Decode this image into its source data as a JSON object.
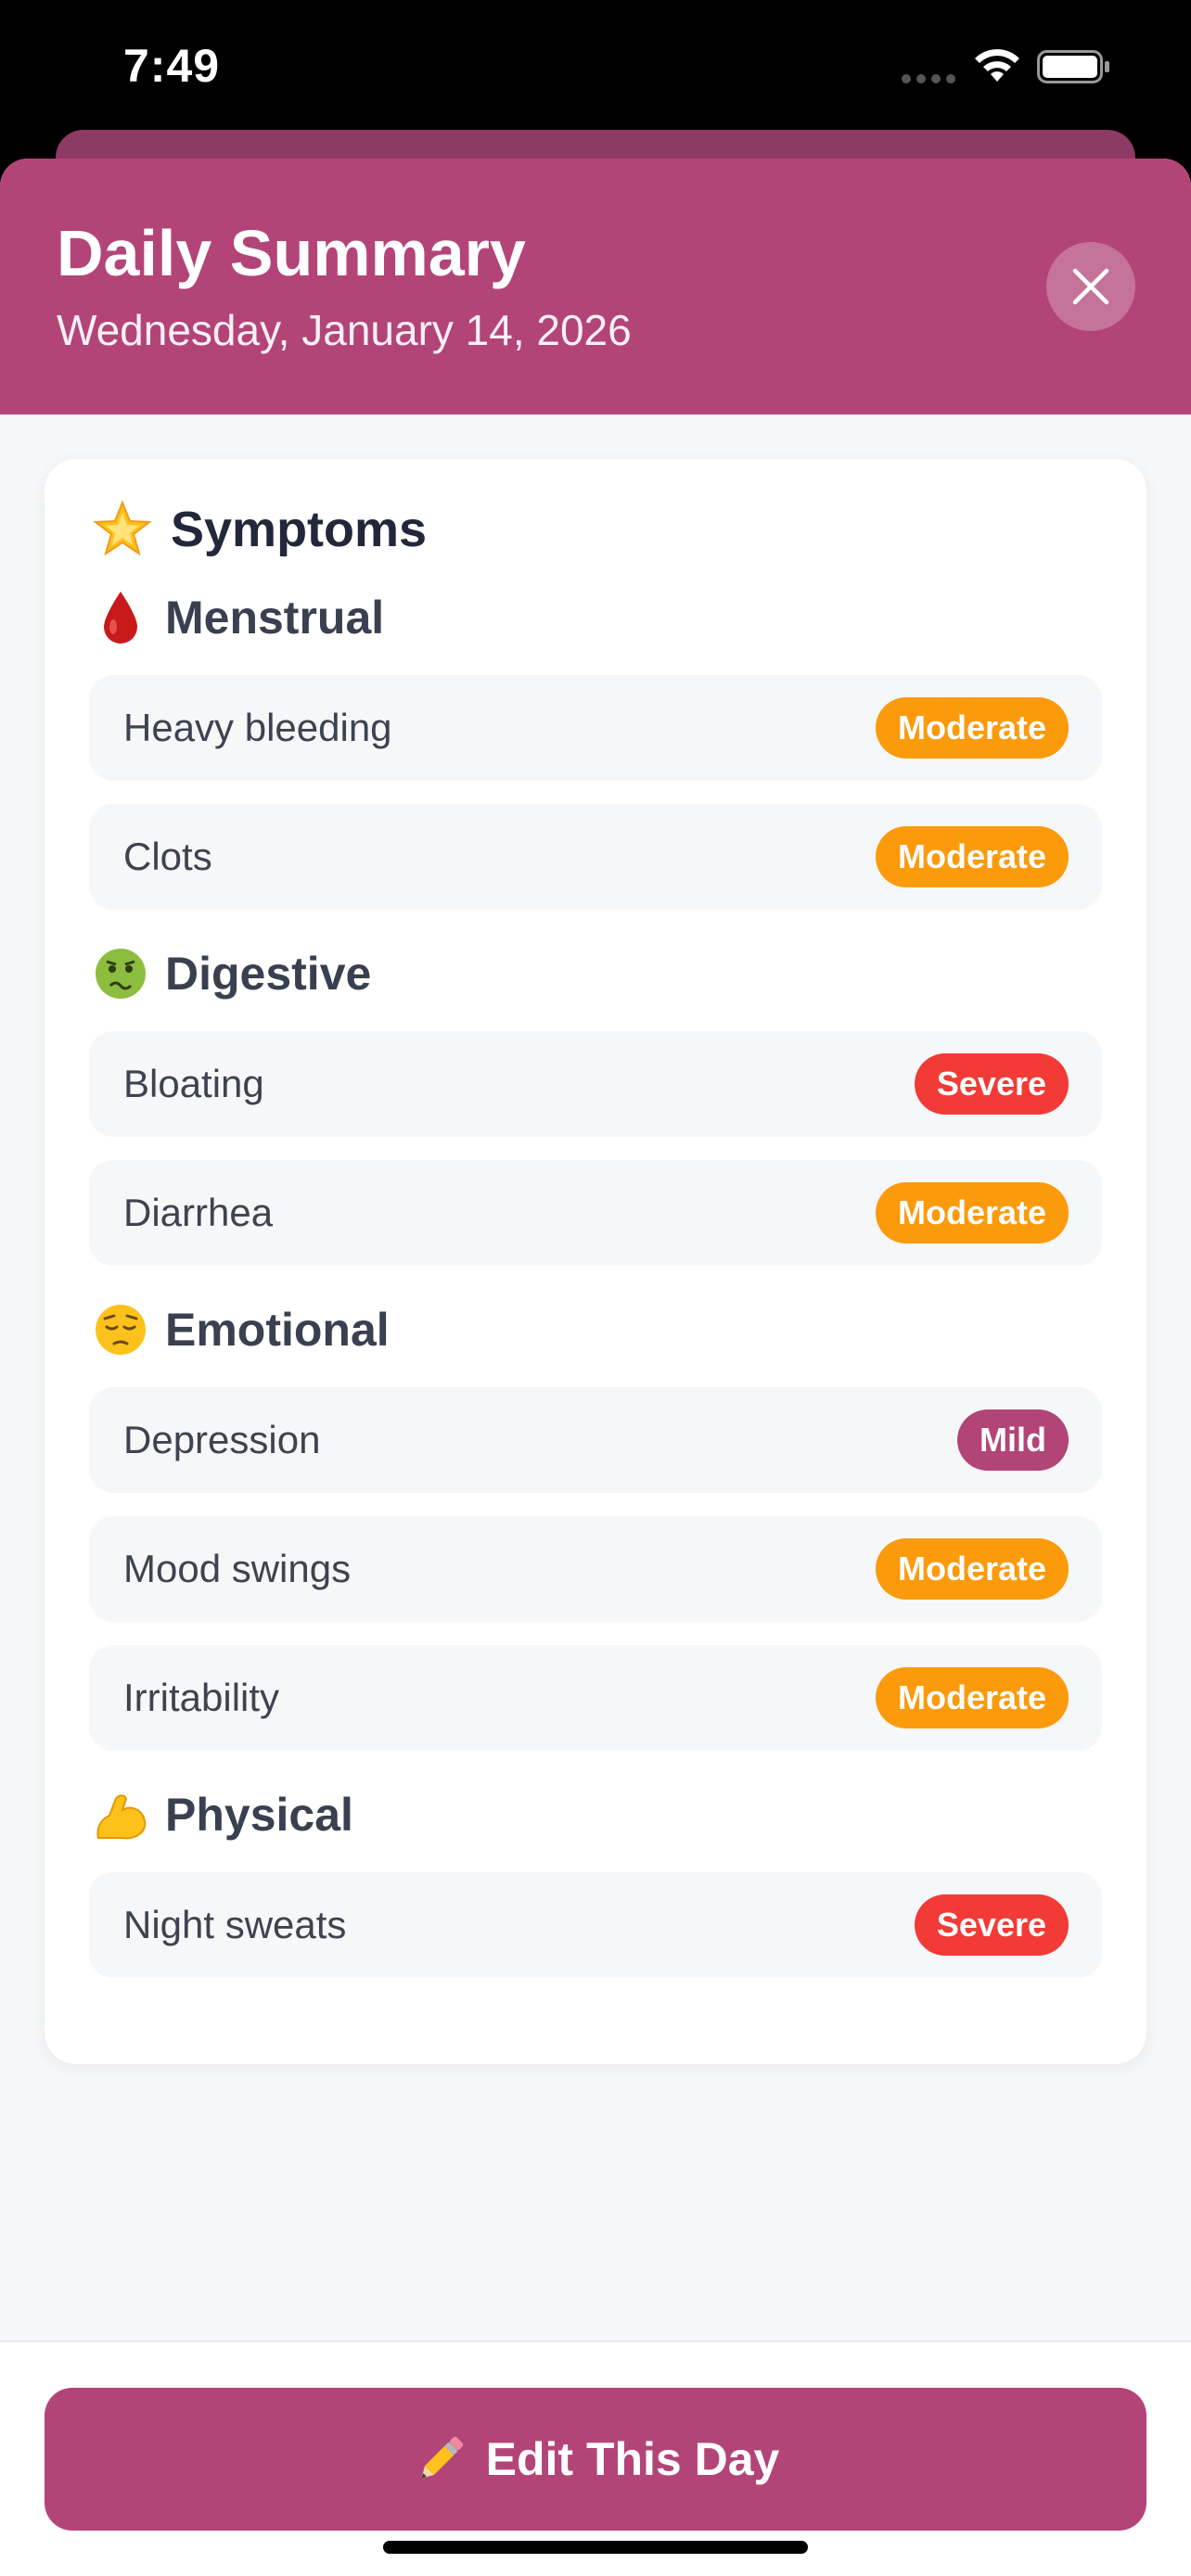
{
  "status_bar": {
    "time": "7:49"
  },
  "header": {
    "title": "Daily Summary",
    "date": "Wednesday, January 14, 2026"
  },
  "symptoms": {
    "title": "Symptoms",
    "title_icon": "star-icon",
    "categories": [
      {
        "name": "Menstrual",
        "icon": "blood-drop-icon",
        "items": [
          {
            "label": "Heavy bleeding",
            "severity": "Moderate"
          },
          {
            "label": "Clots",
            "severity": "Moderate"
          }
        ]
      },
      {
        "name": "Digestive",
        "icon": "nauseated-face-icon",
        "items": [
          {
            "label": "Bloating",
            "severity": "Severe"
          },
          {
            "label": "Diarrhea",
            "severity": "Moderate"
          }
        ]
      },
      {
        "name": "Emotional",
        "icon": "pensive-face-icon",
        "items": [
          {
            "label": "Depression",
            "severity": "Mild"
          },
          {
            "label": "Mood swings",
            "severity": "Moderate"
          },
          {
            "label": "Irritability",
            "severity": "Moderate"
          }
        ]
      },
      {
        "name": "Physical",
        "icon": "flexed-biceps-icon",
        "items": [
          {
            "label": "Night sweats",
            "severity": "Severe"
          }
        ]
      }
    ]
  },
  "edit_button": {
    "label": "Edit This Day",
    "icon": "pencil-icon"
  },
  "colors": {
    "accent": "#b34478",
    "moderate": "#fb9a0b",
    "severe": "#f23a37",
    "mild": "#b34478"
  }
}
